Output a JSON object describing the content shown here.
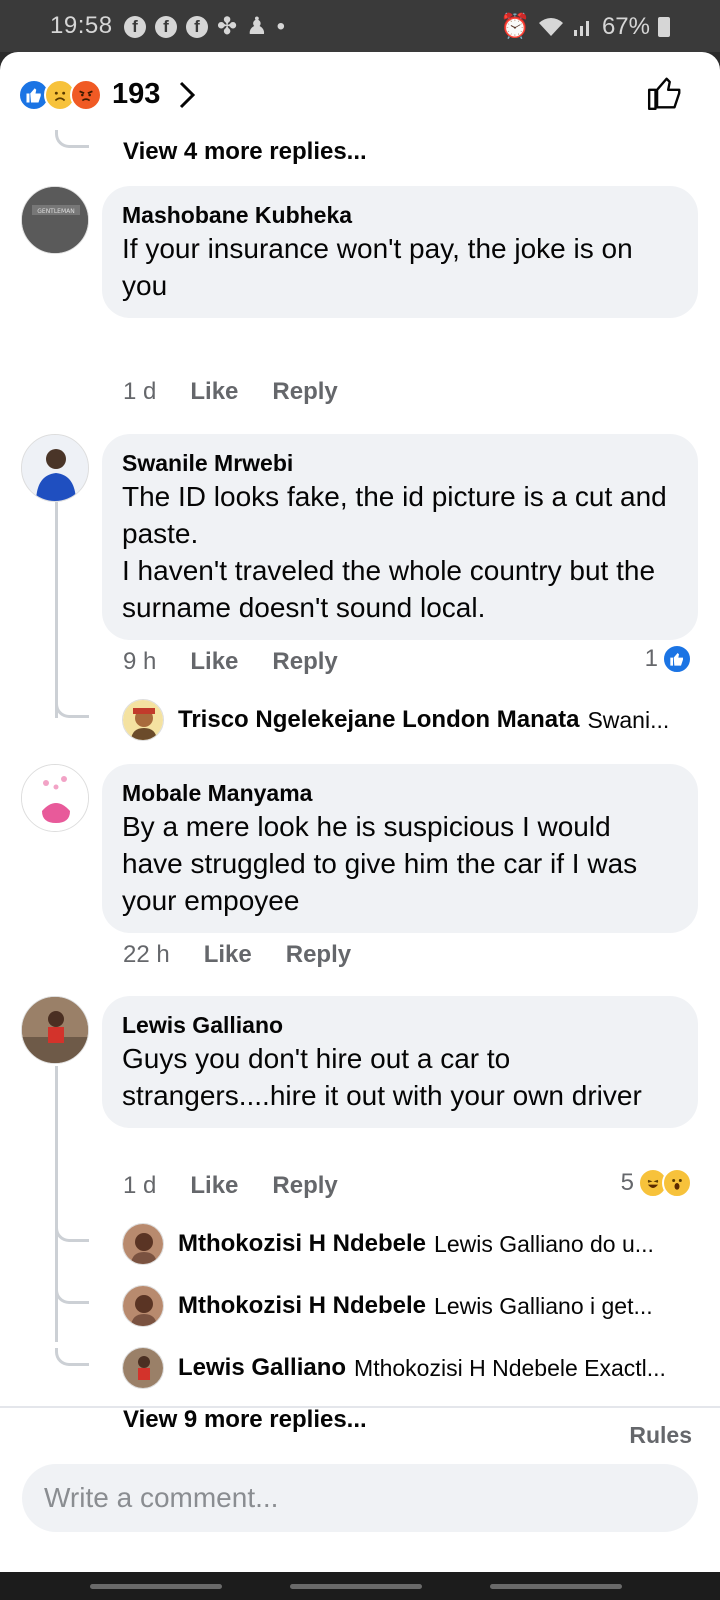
{
  "status_bar": {
    "time": "19:58",
    "battery": "67%",
    "dot": "•"
  },
  "header": {
    "reaction_count": "193"
  },
  "view_more_top": "View 4 more replies...",
  "comments": [
    {
      "author": "Mashobane Kubheka",
      "text": "If your insurance won't pay, the joke is on you",
      "time": "1 d",
      "like": "Like",
      "reply": "Reply"
    },
    {
      "author": "Swanile Mrwebi",
      "text": "The ID looks fake, the id picture is a cut and paste.\nI haven't traveled the whole country but the surname doesn't sound local.",
      "time": "9 h",
      "like": "Like",
      "reply": "Reply",
      "reaction_count": "1",
      "replies": [
        {
          "name": "Trisco Ngelekejane London Manata",
          "text": "Swani..."
        }
      ]
    },
    {
      "author": "Mobale Manyama",
      "text": "By a mere look he is suspicious I would have struggled to give him the car if I was your empoyee",
      "time": "22 h",
      "like": "Like",
      "reply": "Reply"
    },
    {
      "author": "Lewis Galliano",
      "text": "Guys you don't hire out a car to strangers....hire it out with your own driver",
      "time": "1 d",
      "like": "Like",
      "reply": "Reply",
      "reaction_count": "5",
      "replies": [
        {
          "name": "Mthokozisi H Ndebele",
          "text": "Lewis Galliano do u..."
        },
        {
          "name": "Mthokozisi H Ndebele",
          "text": "Lewis Galliano i get..."
        },
        {
          "name": "Lewis Galliano",
          "text": "Mthokozisi H Ndebele Exactl..."
        }
      ],
      "view_more": "View 9 more replies..."
    }
  ],
  "footer": {
    "rules": "Rules",
    "input_placeholder": "Write a comment..."
  },
  "colors": {
    "like_blue": "#1b74e4",
    "bubble": "#f0f2f5",
    "secondary_text": "#65676b"
  }
}
